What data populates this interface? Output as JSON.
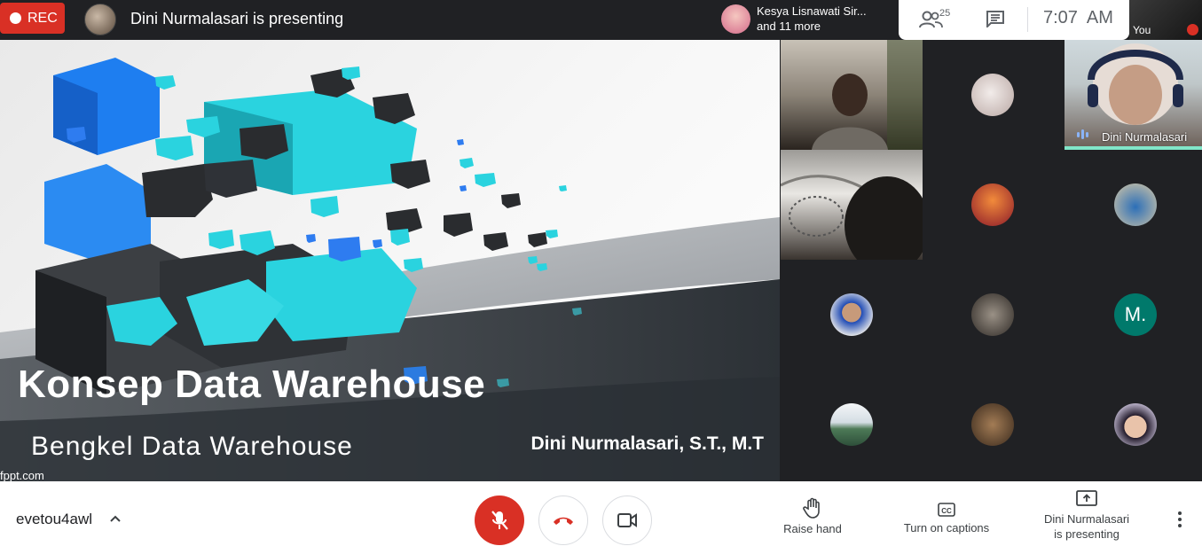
{
  "topbar": {
    "rec_label": "REC",
    "presenting_text": "Dini Nurmalasari is presenting",
    "people_chip_line1": "Kesya Lisnawati Sir...",
    "people_chip_line2": "and 11 more",
    "participant_count": "25",
    "clock": "7:07  AM",
    "self_label": "You"
  },
  "slide": {
    "title": "Konsep Data Warehouse",
    "subtitle": "Bengkel Data Warehouse",
    "author": "Dini Nurmalasari, S.T., M.T",
    "footer": "fppt.com"
  },
  "grid": {
    "active_speaker_name": "Dini Nurmalasari",
    "letter_avatar": "M."
  },
  "bottombar": {
    "meeting_code": "evetou4awl",
    "raise_hand_label": "Raise hand",
    "captions_label": "Turn on captions",
    "presenting_label_line1": "Dini Nurmalasari",
    "presenting_label_line2": "is presenting"
  },
  "icons": {
    "rec": "record-dot-icon",
    "people": "people-icon",
    "chat": "chat-icon",
    "mic_off": "mic-off-icon",
    "hang_up": "phone-hangup-icon",
    "camera": "camera-icon",
    "raise_hand": "hand-icon",
    "captions": "cc-icon",
    "present": "present-screen-icon",
    "more": "more-vert-icon",
    "chevron": "chevron-up-icon"
  },
  "colors": {
    "rec_red": "#d93025",
    "topbar": "#202124",
    "accent_teal": "#81e6c9",
    "letter_avatar": "#00796b"
  }
}
